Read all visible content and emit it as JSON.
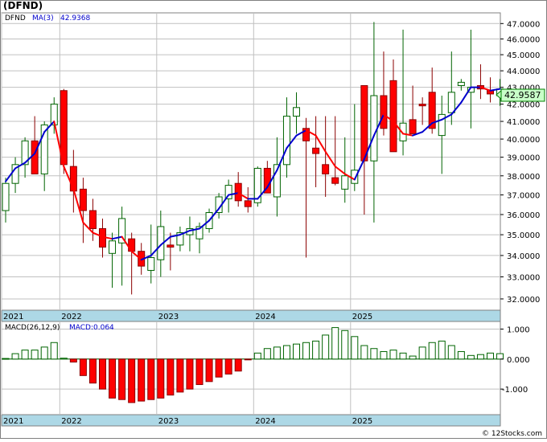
{
  "title": "(DFND)",
  "footer": "© 12Stocks.com",
  "colors": {
    "up_fill": "#ffffff",
    "up_stroke": "#006400",
    "down_fill": "#ff0000",
    "down_stroke": "#8b0000",
    "ma_up": "#0000cc",
    "ma_down": "#ff0000",
    "macd_pos_fill": "#ffffff",
    "macd_pos_stroke": "#006400",
    "macd_neg_fill": "#ff0000",
    "macd_neg_stroke": "#8b0000",
    "grid": "#c0c0c0",
    "axis_band": "#add8e6",
    "last_box": "#c8ffc8"
  },
  "chart_data": [
    {
      "type": "candlestick",
      "panel": "price",
      "legend": {
        "symbol": "DFND",
        "ma_label": "MA(3)",
        "ma_value": "42.9368"
      },
      "last_price": "42.9587",
      "ylim": [
        31.5,
        47.6
      ],
      "log_scale": true,
      "grid": true,
      "y_ticks": [
        "32.0000",
        "33.0000",
        "34.0000",
        "35.0000",
        "36.0000",
        "37.0000",
        "38.0000",
        "39.0000",
        "40.0000",
        "41.0000",
        "42.0000",
        "43.0000",
        "44.0000",
        "45.0000",
        "46.0000",
        "47.0000"
      ],
      "x_labels": [
        "2021",
        "2022",
        "2023",
        "2024",
        "2025"
      ],
      "x_label_index": [
        0,
        6,
        16,
        26,
        36
      ],
      "ohlc": [
        [
          36.2,
          37.9,
          35.6,
          37.6
        ],
        [
          37.6,
          39.0,
          37.1,
          38.6
        ],
        [
          38.6,
          40.1,
          37.9,
          39.9
        ],
        [
          39.9,
          41.3,
          38.1,
          38.1
        ],
        [
          38.1,
          41.0,
          37.2,
          40.8
        ],
        [
          40.8,
          42.4,
          40.3,
          42.0
        ],
        [
          42.8,
          42.9,
          38.1,
          38.6
        ],
        [
          38.5,
          39.4,
          36.1,
          37.2
        ],
        [
          37.3,
          37.9,
          34.6,
          36.2
        ],
        [
          36.2,
          36.8,
          34.7,
          35.3
        ],
        [
          35.3,
          35.8,
          33.9,
          34.4
        ],
        [
          34.1,
          35.1,
          32.5,
          34.7
        ],
        [
          34.6,
          36.4,
          32.6,
          35.8
        ],
        [
          34.8,
          35.1,
          32.2,
          34.2
        ],
        [
          34.2,
          34.6,
          33.1,
          33.5
        ],
        [
          33.3,
          35.5,
          32.7,
          33.9
        ],
        [
          33.8,
          36.2,
          33.0,
          35.4
        ],
        [
          34.5,
          35.1,
          33.3,
          34.4
        ],
        [
          34.5,
          35.4,
          34.2,
          35.1
        ],
        [
          35.0,
          35.9,
          34.2,
          35.3
        ],
        [
          34.8,
          35.6,
          34.1,
          35.4
        ],
        [
          35.3,
          36.3,
          35.1,
          36.1
        ],
        [
          36.1,
          37.1,
          35.8,
          36.9
        ],
        [
          36.8,
          37.8,
          36.1,
          37.5
        ],
        [
          37.6,
          38.2,
          36.4,
          36.7
        ],
        [
          36.7,
          37.4,
          36.1,
          36.4
        ],
        [
          36.6,
          38.5,
          36.4,
          38.4
        ],
        [
          38.4,
          38.8,
          37.1,
          37.1
        ],
        [
          36.9,
          40.1,
          35.9,
          38.6
        ],
        [
          38.6,
          42.4,
          37.9,
          41.3
        ],
        [
          41.3,
          42.7,
          40.3,
          41.8
        ],
        [
          40.6,
          41.2,
          33.9,
          39.9
        ],
        [
          39.5,
          41.3,
          37.4,
          39.2
        ],
        [
          38.6,
          41.3,
          36.9,
          38.1
        ],
        [
          37.9,
          41.3,
          37.5,
          37.6
        ],
        [
          37.3,
          40.1,
          36.6,
          38.0
        ],
        [
          37.6,
          42.0,
          37.2,
          38.3
        ],
        [
          43.1,
          43.1,
          36.0,
          38.8
        ],
        [
          38.8,
          47.1,
          35.6,
          42.5
        ],
        [
          42.5,
          45.2,
          40.2,
          40.6
        ],
        [
          43.4,
          44.7,
          39.3,
          39.3
        ],
        [
          39.9,
          46.6,
          39.1,
          40.9
        ],
        [
          41.1,
          43.1,
          40.8,
          40.3
        ],
        [
          42.0,
          42.4,
          40.8,
          41.9
        ],
        [
          42.7,
          44.2,
          40.3,
          40.6
        ],
        [
          40.2,
          42.5,
          38.1,
          41.4
        ],
        [
          41.5,
          45.2,
          40.8,
          42.7
        ],
        [
          43.1,
          43.5,
          42.8,
          43.3
        ],
        [
          42.7,
          46.6,
          40.6,
          43.0
        ],
        [
          43.1,
          44.4,
          42.3,
          42.9
        ],
        [
          42.8,
          43.6,
          42.1,
          42.6
        ],
        [
          42.5,
          43.5,
          41.9,
          42.9
        ]
      ],
      "ma3": [
        37.7,
        38.4,
        38.7,
        39.2,
        40.4,
        41.0,
        38.5,
        37.3,
        35.6,
        35.1,
        34.9,
        34.8,
        34.9,
        34.2,
        33.8,
        34.0,
        34.5,
        34.9,
        35.0,
        35.2,
        35.3,
        35.7,
        36.3,
        37.0,
        37.1,
        36.8,
        36.8,
        37.4,
        38.3,
        39.5,
        40.2,
        40.5,
        40.2,
        39.3,
        38.5,
        38.1,
        37.8,
        38.9,
        40.2,
        41.4,
        41.0,
        40.3,
        40.2,
        40.4,
        40.9,
        41.1,
        41.4,
        42.1,
        43.0,
        43.0,
        42.8,
        42.9
      ]
    },
    {
      "type": "bar",
      "panel": "macd",
      "legend": {
        "label": "MACD(26,12,9)",
        "value_label": "MACD:0.064"
      },
      "ylim": [
        -1.8,
        1.2
      ],
      "y_ticks": [
        "1.000",
        "0.000",
        "-1.000"
      ],
      "y_tick_values": [
        1.0,
        0.0,
        -1.0
      ],
      "x_labels": [
        "2021",
        "2022",
        "2023",
        "2024",
        "2025"
      ],
      "values": [
        0.02,
        0.18,
        0.3,
        0.3,
        0.4,
        0.55,
        0.03,
        -0.1,
        -0.55,
        -0.8,
        -1.0,
        -1.3,
        -1.35,
        -1.45,
        -1.4,
        -1.35,
        -1.3,
        -1.2,
        -1.1,
        -1.0,
        -0.85,
        -0.75,
        -0.6,
        -0.5,
        -0.4,
        -0.02,
        0.2,
        0.35,
        0.4,
        0.45,
        0.5,
        0.55,
        0.6,
        0.8,
        1.05,
        0.95,
        0.75,
        0.45,
        0.35,
        0.25,
        0.3,
        0.2,
        0.1,
        0.4,
        0.55,
        0.6,
        0.45,
        0.25,
        0.12,
        0.15,
        0.2,
        0.18
      ]
    }
  ]
}
